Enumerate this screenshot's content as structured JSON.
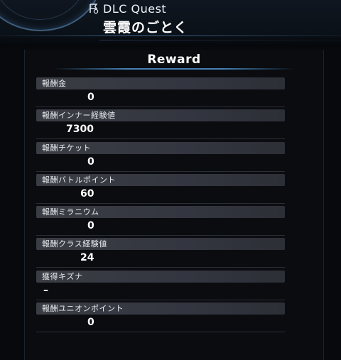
{
  "header": {
    "quest_type": "DLC Quest",
    "quest_name": "雲霞のごとく"
  },
  "panel": {
    "title": "Reward"
  },
  "rewards": [
    {
      "label": "報酬金",
      "value": "0"
    },
    {
      "label": "報酬インナー経験値",
      "value": "7300"
    },
    {
      "label": "報酬チケット",
      "value": "0"
    },
    {
      "label": "報酬バトルポイント",
      "value": "60"
    },
    {
      "label": "報酬ミラニウム",
      "value": "0"
    },
    {
      "label": "報酬クラス経験値",
      "value": "24"
    },
    {
      "label": "獲得キズナ",
      "value": "–"
    },
    {
      "label": "報酬ユニオンポイント",
      "value": "0"
    }
  ],
  "colors": {
    "background": "#07090d",
    "label_bar": "#3a3d43",
    "accent_line": "#5096d2"
  },
  "icons": {
    "quest": "quest-marker-icon"
  }
}
